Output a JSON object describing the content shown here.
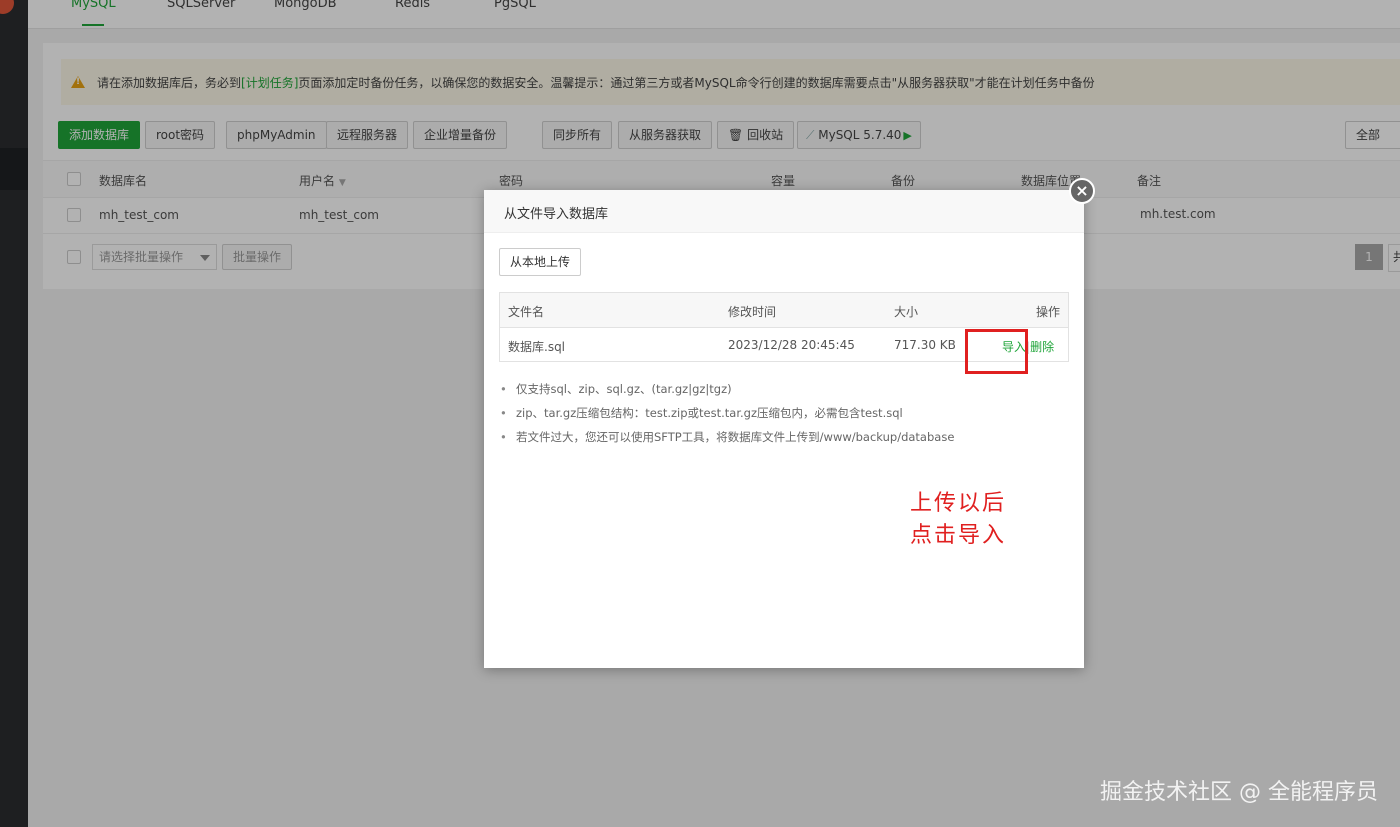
{
  "tabs": [
    "MySQL",
    "SQLServer",
    "MongoDB",
    "Redis",
    "PgSQL"
  ],
  "notice": {
    "prefix": "请在添加数据库后，务必到",
    "link": "[计划任务]",
    "suffix": "页面添加定时备份任务，以确保您的数据安全。温馨提示：通过第三方或者MySQL命令行创建的数据库需要点击\"从服务器获取\"才能在计划任务中备份"
  },
  "toolbar": {
    "add_db": "添加数据库",
    "root_pwd": "root密码",
    "phpmyadmin": "phpMyAdmin",
    "remote": "远程服务器",
    "enterprise_backup": "企业增量备份",
    "sync_all": "同步所有",
    "fetch_server": "从服务器获取",
    "recycle": "回收站",
    "mysql_version": "MySQL 5.7.40",
    "filter_all": "全部"
  },
  "table": {
    "headers": [
      "数据库名",
      "用户名",
      "密码",
      "容量",
      "备份",
      "数据库位置",
      "备注"
    ],
    "rows": [
      {
        "name": "mh_test_com",
        "user": "mh_test_com",
        "note": "mh.test.com"
      }
    ]
  },
  "batch": {
    "select_placeholder": "请选择批量操作",
    "batch_button": "批量操作",
    "page": "1",
    "page_extra": "共"
  },
  "modal": {
    "title": "从文件导入数据库",
    "upload_button": "从本地上传",
    "columns": [
      "文件名",
      "修改时间",
      "大小",
      "操作"
    ],
    "files": [
      {
        "name": "数据库.sql",
        "mtime": "2023/12/28 20:45:45",
        "size": "717.30 KB",
        "import": "导入",
        "sep": "|",
        "delete": "删除"
      }
    ],
    "notes": [
      "仅支持sql、zip、sql.gz、(tar.gz|gz|tgz)",
      "zip、tar.gz压缩包结构：test.zip或test.tar.gz压缩包内，必需包含test.sql",
      "若文件过大，您还可以使用SFTP工具，将数据库文件上传到/www/backup/database"
    ]
  },
  "annotation": {
    "line1": "上传以后",
    "line2": "点击导入"
  },
  "watermark": "掘金技术社区 @ 全能程序员"
}
